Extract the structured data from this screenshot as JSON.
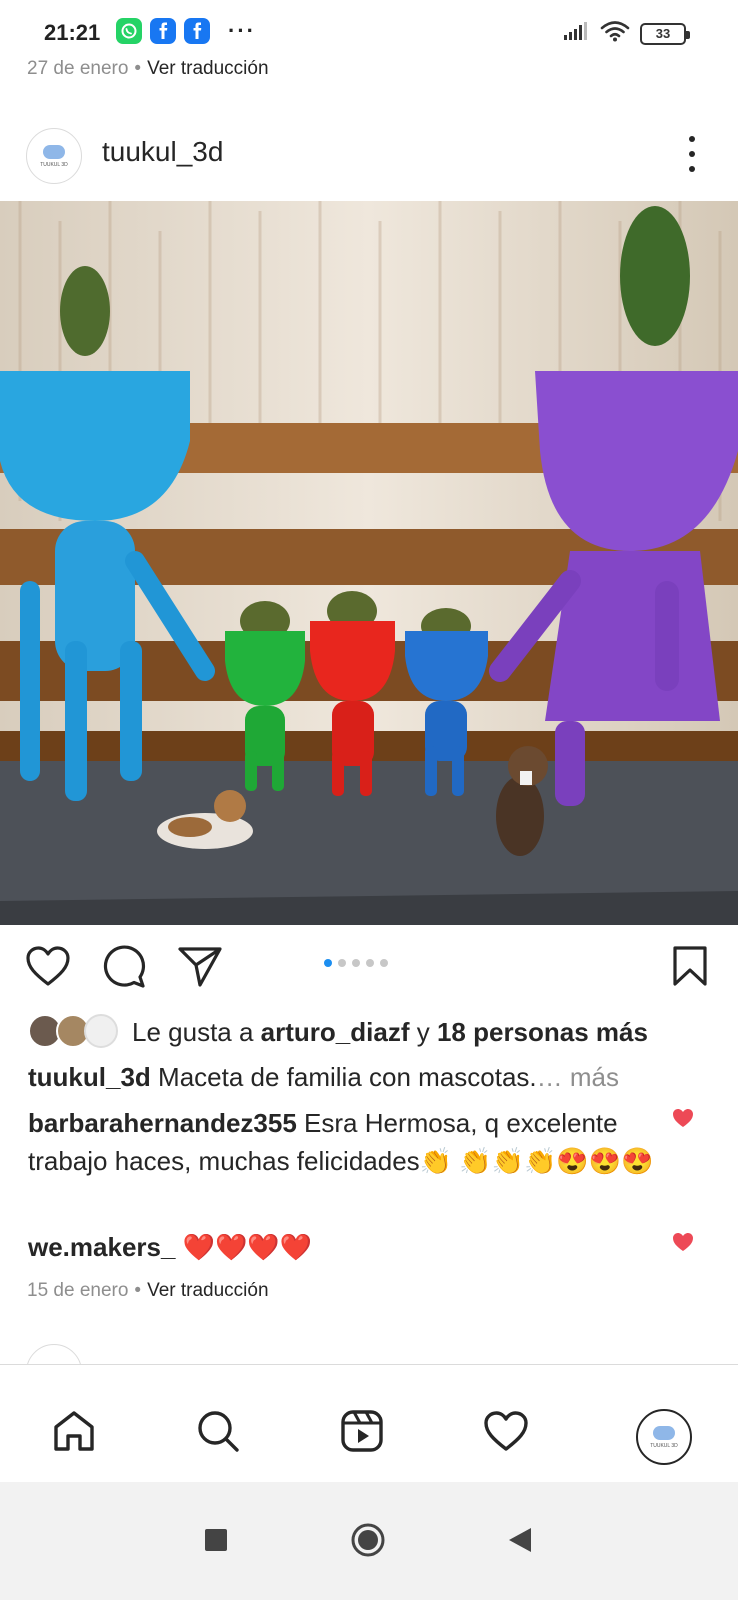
{
  "status_bar": {
    "time": "21:21",
    "battery": "33",
    "overflow": "···",
    "apps": [
      "whatsapp-icon",
      "facebook-icon",
      "facebook-icon"
    ]
  },
  "previous_post": {
    "date": "27 de enero",
    "separator": "•",
    "translate": "Ver traducción"
  },
  "post": {
    "username": "tuukul_3d",
    "avatar_text": "TUUKUL 3D",
    "carousel": {
      "count": 5,
      "active_index": 0
    },
    "likes": {
      "prefix": "Le gusta a",
      "user": "arturo_diazf",
      "connector": "y",
      "others": "18 personas más"
    },
    "caption": {
      "user": "tuukul_3d",
      "text": "Maceta de familia con mascotas.",
      "more": "… más"
    },
    "comments": [
      {
        "user": "barbarahernandez355",
        "text": "Esra Hermosa, q excelente trabajo haces, muchas felicidades👏 👏👏👏😍😍😍",
        "liked": true
      },
      {
        "user": "we.makers_",
        "text": "❤️❤️❤️❤️",
        "liked": true
      }
    ],
    "date": "15 de enero",
    "separator": "•",
    "translate": "Ver traducción"
  },
  "colors": {
    "text": "#262626",
    "muted": "#8e8e8e",
    "accent_blue": "#1c8ef0",
    "like_red": "#ed4956"
  },
  "bottom_nav": [
    "home-icon",
    "search-icon",
    "reels-icon",
    "activity-heart-icon",
    "profile-avatar"
  ],
  "system_nav": [
    "recents-button",
    "home-button",
    "back-button"
  ]
}
